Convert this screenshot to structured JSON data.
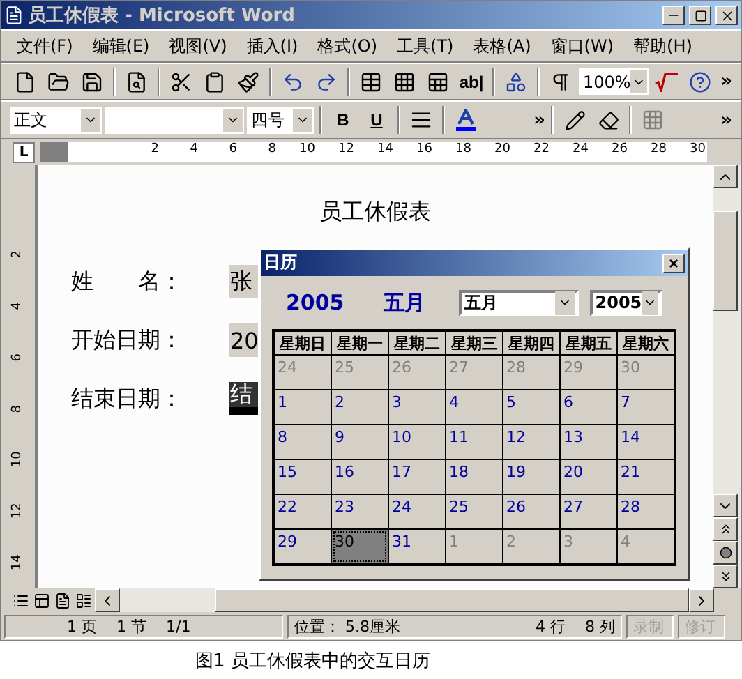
{
  "window": {
    "title": "员工休假表 - Microsoft Word"
  },
  "menu": [
    "文件(F)",
    "编辑(E)",
    "视图(V)",
    "插入(I)",
    "格式(O)",
    "工具(T)",
    "表格(A)",
    "窗口(W)",
    "帮助(H)"
  ],
  "toolbar": {
    "form_field_label": "ab|",
    "zoom": "100%",
    "more": "»"
  },
  "format_bar": {
    "style": "正文",
    "size": "四号",
    "bold": "B",
    "underline": "U",
    "more": "»"
  },
  "ruler": {
    "tab_stop": "L",
    "numbers": [
      "2",
      "4",
      "6",
      "8",
      "10",
      "12",
      "14",
      "16",
      "18",
      "20",
      "22",
      "24",
      "26",
      "28",
      "30"
    ]
  },
  "vertical_ruler": {
    "numbers": [
      "2",
      "4",
      "6",
      "8",
      "10",
      "12",
      "14"
    ]
  },
  "document": {
    "title": "员工休假表",
    "rows": [
      {
        "label": "姓　　名：",
        "value": "张",
        "selected": false
      },
      {
        "label": "开始日期：",
        "value": "20",
        "selected": false
      },
      {
        "label": "结束日期：",
        "value": "结",
        "selected": true
      }
    ]
  },
  "calendar": {
    "title": "日历",
    "close": "×",
    "year": "2005",
    "month": "五月",
    "month_select": "五月",
    "year_select": "2005",
    "weekdays": [
      "星期日",
      "星期一",
      "星期二",
      "星期三",
      "星期四",
      "星期五",
      "星期六"
    ],
    "weeks": [
      [
        {
          "day": "24",
          "in_month": false,
          "selected": false
        },
        {
          "day": "25",
          "in_month": false,
          "selected": false
        },
        {
          "day": "26",
          "in_month": false,
          "selected": false
        },
        {
          "day": "27",
          "in_month": false,
          "selected": false
        },
        {
          "day": "28",
          "in_month": false,
          "selected": false
        },
        {
          "day": "29",
          "in_month": false,
          "selected": false
        },
        {
          "day": "30",
          "in_month": false,
          "selected": false
        }
      ],
      [
        {
          "day": "1",
          "in_month": true,
          "selected": false
        },
        {
          "day": "2",
          "in_month": true,
          "selected": false
        },
        {
          "day": "3",
          "in_month": true,
          "selected": false
        },
        {
          "day": "4",
          "in_month": true,
          "selected": false
        },
        {
          "day": "5",
          "in_month": true,
          "selected": false
        },
        {
          "day": "6",
          "in_month": true,
          "selected": false
        },
        {
          "day": "7",
          "in_month": true,
          "selected": false
        }
      ],
      [
        {
          "day": "8",
          "in_month": true,
          "selected": false
        },
        {
          "day": "9",
          "in_month": true,
          "selected": false
        },
        {
          "day": "10",
          "in_month": true,
          "selected": false
        },
        {
          "day": "11",
          "in_month": true,
          "selected": false
        },
        {
          "day": "12",
          "in_month": true,
          "selected": false
        },
        {
          "day": "13",
          "in_month": true,
          "selected": false
        },
        {
          "day": "14",
          "in_month": true,
          "selected": false
        }
      ],
      [
        {
          "day": "15",
          "in_month": true,
          "selected": false
        },
        {
          "day": "16",
          "in_month": true,
          "selected": false
        },
        {
          "day": "17",
          "in_month": true,
          "selected": false
        },
        {
          "day": "18",
          "in_month": true,
          "selected": false
        },
        {
          "day": "19",
          "in_month": true,
          "selected": false
        },
        {
          "day": "20",
          "in_month": true,
          "selected": false
        },
        {
          "day": "21",
          "in_month": true,
          "selected": false
        }
      ],
      [
        {
          "day": "22",
          "in_month": true,
          "selected": false
        },
        {
          "day": "23",
          "in_month": true,
          "selected": false
        },
        {
          "day": "24",
          "in_month": true,
          "selected": false
        },
        {
          "day": "25",
          "in_month": true,
          "selected": false
        },
        {
          "day": "26",
          "in_month": true,
          "selected": false
        },
        {
          "day": "27",
          "in_month": true,
          "selected": false
        },
        {
          "day": "28",
          "in_month": true,
          "selected": false
        }
      ],
      [
        {
          "day": "29",
          "in_month": true,
          "selected": false
        },
        {
          "day": "30",
          "in_month": true,
          "selected": true
        },
        {
          "day": "31",
          "in_month": true,
          "selected": false
        },
        {
          "day": "1",
          "in_month": false,
          "selected": false
        },
        {
          "day": "2",
          "in_month": false,
          "selected": false
        },
        {
          "day": "3",
          "in_month": false,
          "selected": false
        },
        {
          "day": "4",
          "in_month": false,
          "selected": false
        }
      ]
    ]
  },
  "status_bar": {
    "items": [
      {
        "text": "1 页",
        "disabled": false
      },
      {
        "text": "1 节",
        "disabled": false
      },
      {
        "text": "1/1",
        "disabled": false
      },
      {
        "text": "位置： 5.8厘米",
        "disabled": false
      },
      {
        "text": "4 行",
        "disabled": false
      },
      {
        "text": "8 列",
        "disabled": false
      },
      {
        "text": "录制",
        "disabled": true
      },
      {
        "text": "修订",
        "disabled": true
      }
    ]
  },
  "caption": "图1  员工休假表中的交互日历"
}
